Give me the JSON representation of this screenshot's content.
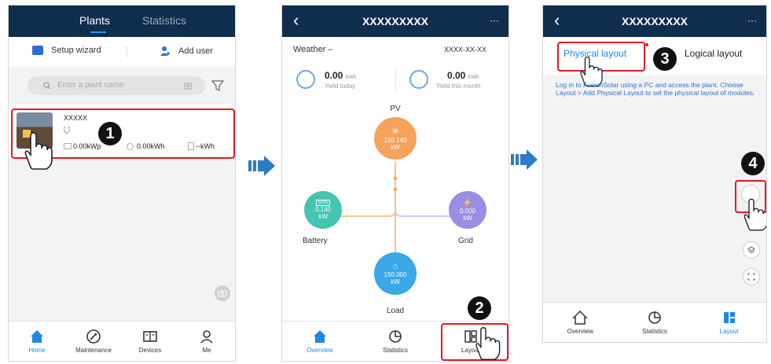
{
  "screen1": {
    "tabs": [
      "Plants",
      "Statistics"
    ],
    "setup_wizard": "Setup wizard",
    "add_user": "Add user",
    "search_placeholder": "Enter a plant name.",
    "plant": {
      "name": "XXXXX",
      "capacity": "0.00kWp",
      "energy": "0.00kWh",
      "yield": "--kWh"
    },
    "step": "1",
    "nav": [
      "Home",
      "Maintenance",
      "Devices",
      "Me"
    ]
  },
  "screen2": {
    "title": "XXXXXXXXX",
    "more": "···",
    "weather": "Weather –",
    "date": "XXXX-XX-XX",
    "yield_today_value": "0.00",
    "yield_today_unit": "kWh",
    "yield_today_label": "Yield today",
    "yield_month_value": "0.00",
    "yield_month_unit": "kWh",
    "yield_month_label": "Yield this month",
    "pv_label": "PV",
    "pv_value": "150.140",
    "pv_unit": "kW",
    "battery_label": "Battery",
    "battery_percent": "50%",
    "battery_value": "0.140",
    "battery_unit": "kW",
    "grid_label": "Grid",
    "grid_value": "0.000",
    "grid_unit": "kW",
    "load_label": "Load",
    "load_value": "150.000",
    "load_unit": "kW",
    "step": "2",
    "nav": [
      "Overview",
      "Statistics",
      "Layout"
    ]
  },
  "screen3": {
    "title": "XXXXXXXXX",
    "more": "···",
    "tab_physical": "Physical layout",
    "tab_logical": "Logical layout",
    "info": "Log in to FusionSolar using a PC and access the plant. Choose Layout > Add Physical Layout to set the physical layout of modules.",
    "step3": "3",
    "step4": "4",
    "nav": [
      "Overview",
      "Statistics",
      "Layout"
    ]
  },
  "colors": {
    "header": "#0f2d4d",
    "accent": "#1e88e5",
    "highlight": "#e01b24",
    "pv": "#f5a25a",
    "battery": "#45c4b0",
    "grid": "#9b8de6",
    "load": "#38a8e6"
  }
}
